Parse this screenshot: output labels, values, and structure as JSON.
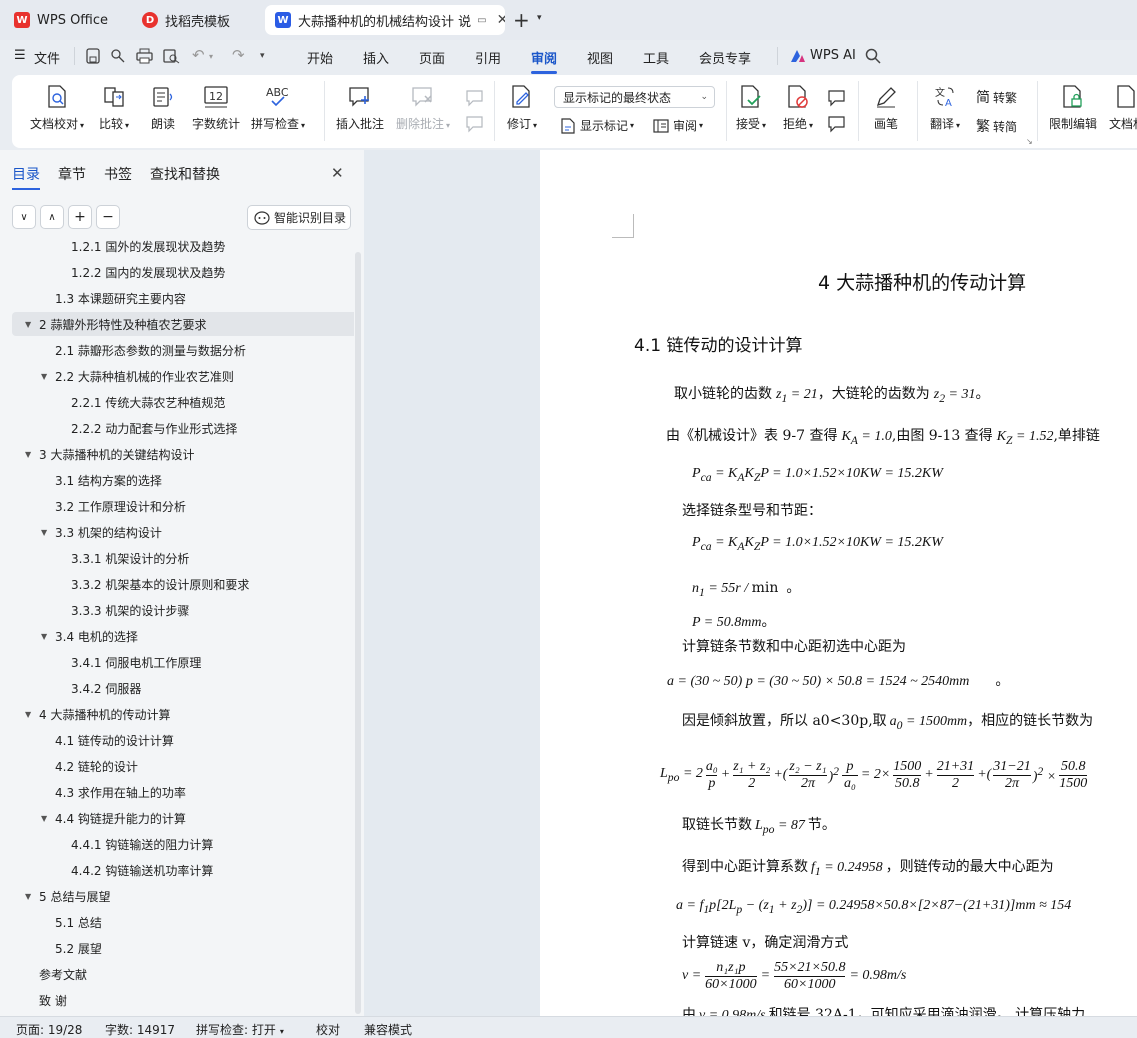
{
  "tabs": [
    {
      "label": "WPS Office",
      "logo": "W",
      "logo_color": "#e8322e"
    },
    {
      "label": "找稻壳模板",
      "logo": "D",
      "logo_color": "#e8322e"
    },
    {
      "label": "大蒜播种机的机械结构设计 说",
      "logo": "W",
      "logo_color": "#2b5ce5"
    }
  ],
  "menu": {
    "file": "文件",
    "items": [
      "开始",
      "插入",
      "页面",
      "引用",
      "审阅",
      "视图",
      "工具",
      "会员专享"
    ],
    "active": "审阅",
    "wps_ai": "WPS AI"
  },
  "ribbon": {
    "doc_check": "文档校对",
    "compare": "比较",
    "read_aloud": "朗读",
    "word_count": "字数统计",
    "spell_check": "拼写检查",
    "insert_comment": "插入批注",
    "delete_comment": "删除批注",
    "markup_select": "显示标记的最终状态",
    "revise": "修订",
    "show_markup": "显示标记",
    "review": "审阅",
    "accept": "接受",
    "reject": "拒绝",
    "pen": "画笔",
    "translate": "翻译",
    "to_traditional": "转繁",
    "to_simplified": "转简",
    "restrict_edit": "限制编辑",
    "doc_trunc": "文档权",
    "wordcount_icon_text": "12",
    "spell_icon_text": "ABC"
  },
  "nav": {
    "tabs": [
      "目录",
      "章节",
      "书签",
      "查找和替换"
    ],
    "smart_toc": "智能识别目录",
    "toc": [
      {
        "text": "1.2.1 国外的发展现状及趋势",
        "level": 3
      },
      {
        "text": "1.2.2 国内的发展现状及趋势",
        "level": 3
      },
      {
        "text": "1.3 本课题研究主要内容",
        "level": 2
      },
      {
        "text": "2  蒜瓣外形特性及种植农艺要求",
        "level": 1,
        "arrow": true,
        "hl": true
      },
      {
        "text": "2.1  蒜瓣形态参数的测量与数据分析",
        "level": 2
      },
      {
        "text": "2.2  大蒜种植机械的作业农艺准则",
        "level": 2,
        "arrow": true
      },
      {
        "text": "2.2.1  传统大蒜农艺种植规范",
        "level": 3
      },
      {
        "text": "2.2.2  动力配套与作业形式选择",
        "level": 3
      },
      {
        "text": "3 大蒜播种机的关键结构设计",
        "level": 1,
        "arrow": true
      },
      {
        "text": "3.1 结构方案的选择",
        "level": 2
      },
      {
        "text": "3.2 工作原理设计和分析",
        "level": 2
      },
      {
        "text": "3.3 机架的结构设计",
        "level": 2,
        "arrow": true
      },
      {
        "text": "3.3.1 机架设计的分析",
        "level": 3
      },
      {
        "text": "3.3.2 机架基本的设计原则和要求",
        "level": 3
      },
      {
        "text": "3.3.3 机架的设计步骤",
        "level": 3
      },
      {
        "text": "3.4 电机的选择",
        "level": 2,
        "arrow": true
      },
      {
        "text": "3.4.1 伺服电机工作原理",
        "level": 3
      },
      {
        "text": "3.4.2 伺服器",
        "level": 3
      },
      {
        "text": "4  大蒜播种机的传动计算",
        "level": 1,
        "arrow": true
      },
      {
        "text": "4.1 链传动的设计计算",
        "level": 2
      },
      {
        "text": "4.2 链轮的设计",
        "level": 2
      },
      {
        "text": "4.3 求作用在轴上的功率",
        "level": 2
      },
      {
        "text": "4.4 钩链提升能力的计算",
        "level": 2,
        "arrow": true
      },
      {
        "text": "4.4.1 钩链输送的阻力计算",
        "level": 3
      },
      {
        "text": "4.4.2 钩链输送机功率计算",
        "level": 3
      },
      {
        "text": "5  总结与展望",
        "level": 1,
        "arrow": true
      },
      {
        "text": "5.1 总结",
        "level": 2
      },
      {
        "text": "5.2 展望",
        "level": 2
      },
      {
        "text": "参考文献",
        "level": 1
      },
      {
        "text": "致   谢",
        "level": 1
      }
    ]
  },
  "doc": {
    "chapter_title": "4  大蒜播种机的传动计算",
    "section_title": "4.1 链传动的设计计算",
    "p1a": "取小链轮的齿数",
    "p1b": "，大链轮的齿数为",
    "p1c": "。",
    "p2a": "由《机械设计》表 9-7 查得",
    "p2b": ",由图 9-13 查得",
    "p2c": ",单排链",
    "f1": "P",
    "p3": "选择链条型号和节距：",
    "p4": "计算链条节数和中心距初选中心距为",
    "p5a": "因是倾斜放置，所以 a0<30p,取",
    "p5b": "，相应的链长节数为",
    "p6a": "取链长节数",
    "p6b": "节。",
    "p7a": "得到中心距计算系数",
    "p7b": "，则链传动的最大中心距为",
    "p8": "计算链速 v，确定润滑方式",
    "p9a": "由",
    "p9b": "和链号 32A-1，可知应采用滴油润滑。  计算压轴力",
    "m_z1": "z₁ = 21",
    "m_z2": "z₂ = 31",
    "m_ka": "K_A = 1.0",
    "m_kz": "K_Z = 1.52",
    "m_pca": "P_ca = K_A K_Z P = 1.0×1.52×10KW = 15.2KW",
    "m_n1": "n₁ = 55r / min",
    "m_n1_tail": "。",
    "m_p": "P = 50.8mm",
    "m_p_tail": "。",
    "m_a": "a = (30 ~ 50) p = (30 ~ 50) × 50.8 = 1524 ~ 2540mm",
    "m_a_tail": "。",
    "m_a0": "a₀ = 1500mm",
    "m_lpo_lhs": "L_po = 2",
    "m_lpo_rest": "= 2×",
    "f_a0": "a₀",
    "f_p": "p",
    "f_z1z2": "z₁ + z₂",
    "f_2": "2",
    "f_z2z1": "z₂ − z₁",
    "f_2pi": "2π",
    "f_1500": "1500",
    "f_508": "50.8",
    "f_2131": "21+31",
    "f_3121": "31−21",
    "f_508b": "50.8",
    "f_1500b": "1500",
    "m_lpo87": "L_po = 87",
    "m_f1": "f₁ = 0.24958",
    "m_amax": "a = f₁p[2L_p − (z₁ + z₂)] = 0.24958×50.8×[2×87−(21+31)]mm ≈ 154",
    "m_v_lhs": "v =",
    "f_n1z1p": "n₁z₁p",
    "f_601000": "60×1000",
    "f_55": "55×21×50.8",
    "f_601000b": "60×1000",
    "m_v_res": "= 0.98m/s",
    "m_v9": "v = 0.98m/s"
  },
  "status": {
    "page": "页面: 19/28",
    "words": "字数: 14917",
    "spell": "拼写检查: 打开",
    "proof": "校对",
    "compat": "兼容模式"
  },
  "colors": {
    "accent": "#2d63de",
    "tab_red": "#e8322e",
    "tab_blue": "#2b5ce5",
    "ai_pink": "#d6337f"
  }
}
